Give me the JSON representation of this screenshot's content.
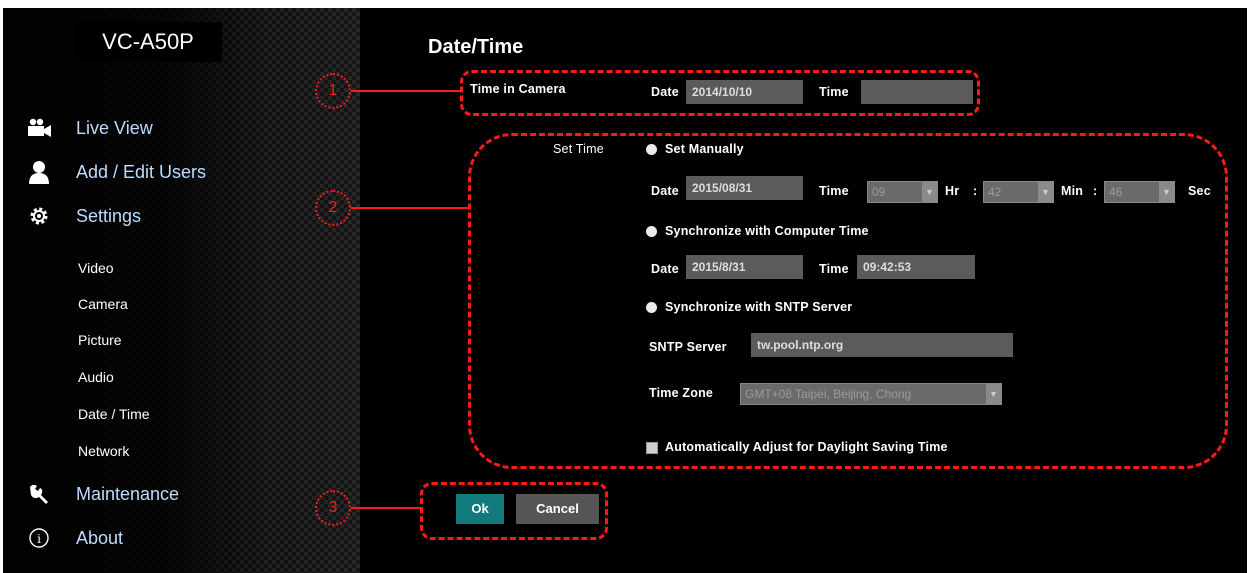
{
  "brand": "VC-A50P",
  "nav": {
    "live_view": "Live View",
    "add_edit_users": "Add / Edit Users",
    "settings": "Settings",
    "sub": [
      "Video",
      "Camera",
      "Picture",
      "Audio",
      "Date / Time",
      "Network"
    ],
    "maintenance": "Maintenance",
    "about": "About"
  },
  "page_title": "Date/Time",
  "time_in_camera": {
    "label": "Time in Camera",
    "date_label": "Date",
    "date_value": "2014/10/10",
    "time_label": "Time",
    "time_value": ""
  },
  "set_time": {
    "label": "Set Time",
    "manual": {
      "option": "Set Manually",
      "date_label": "Date",
      "date_value": "2015/08/31",
      "time_label": "Time",
      "hour": "09",
      "hr_label": "Hr",
      "minute": "42",
      "min_label": "Min",
      "second": "46",
      "sec_label": "Sec",
      "colon": ":"
    },
    "computer": {
      "option": "Synchronize with Computer Time",
      "date_label": "Date",
      "date_value": "2015/8/31",
      "time_label": "Time",
      "time_value": "09:42:53"
    },
    "sntp": {
      "option": "Synchronize with SNTP Server",
      "server_label": "SNTP Server",
      "server_value": "tw.pool.ntp.org",
      "tz_label": "Time Zone",
      "tz_value": "GMT+08 Taipei, Beijing, Chong"
    },
    "dst_label": "Automatically Adjust for Daylight Saving Time"
  },
  "buttons": {
    "ok": "Ok",
    "cancel": "Cancel"
  },
  "callouts": [
    "1",
    "2",
    "3"
  ],
  "colors": {
    "annotation": "#ff1a1a",
    "ok_button": "#117a7a",
    "nav_text": "#bcdcff"
  }
}
